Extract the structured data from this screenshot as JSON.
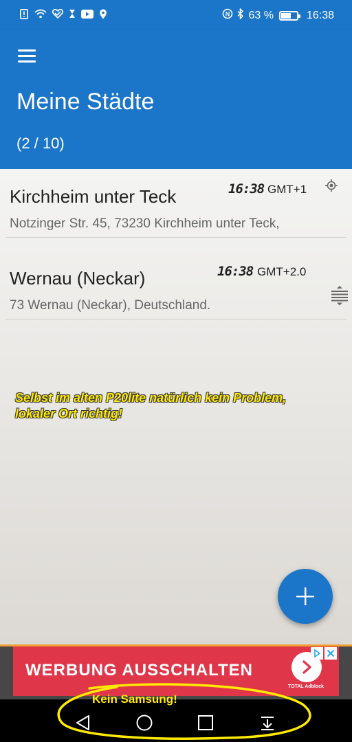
{
  "status_bar": {
    "left_icons": [
      "alert-icon",
      "wifi-icon",
      "heart-icon",
      "hourglass-icon",
      "youtube-icon",
      "location-icon"
    ],
    "battery_percent": "63 %",
    "battery_level": 0.63,
    "time": "16:38"
  },
  "header": {
    "title": "Meine Städte",
    "count": "(2 / 10)",
    "color": "#1b75c9"
  },
  "cities": [
    {
      "name": "Kirchheim unter Teck",
      "address": "Notzinger Str. 45, 73230 Kirchheim unter Teck,",
      "time": "16:38",
      "timezone": "GMT+1",
      "icon": "location-target-icon"
    },
    {
      "name": "Wernau (Neckar)",
      "address": "73 Wernau (Neckar), Deutschland.",
      "time": "16:38",
      "timezone": "GMT+2.0",
      "icon": "drag-handle-icon"
    }
  ],
  "annotation": {
    "line1": "Selbst im alten P20lite natürlich kein Problem,",
    "line2": "lokaler Ort richtig!",
    "color": "#ffea00"
  },
  "fab": {
    "icon": "plus-icon"
  },
  "ad": {
    "text": "WERBUNG AUSSCHALTEN",
    "brand": "TOTAL Adblock",
    "color": "#e0364a"
  },
  "nav": {
    "annotation": "Kein Samsung!",
    "buttons": [
      "back-icon",
      "home-icon",
      "recents-icon",
      "notification-pull-icon"
    ]
  }
}
